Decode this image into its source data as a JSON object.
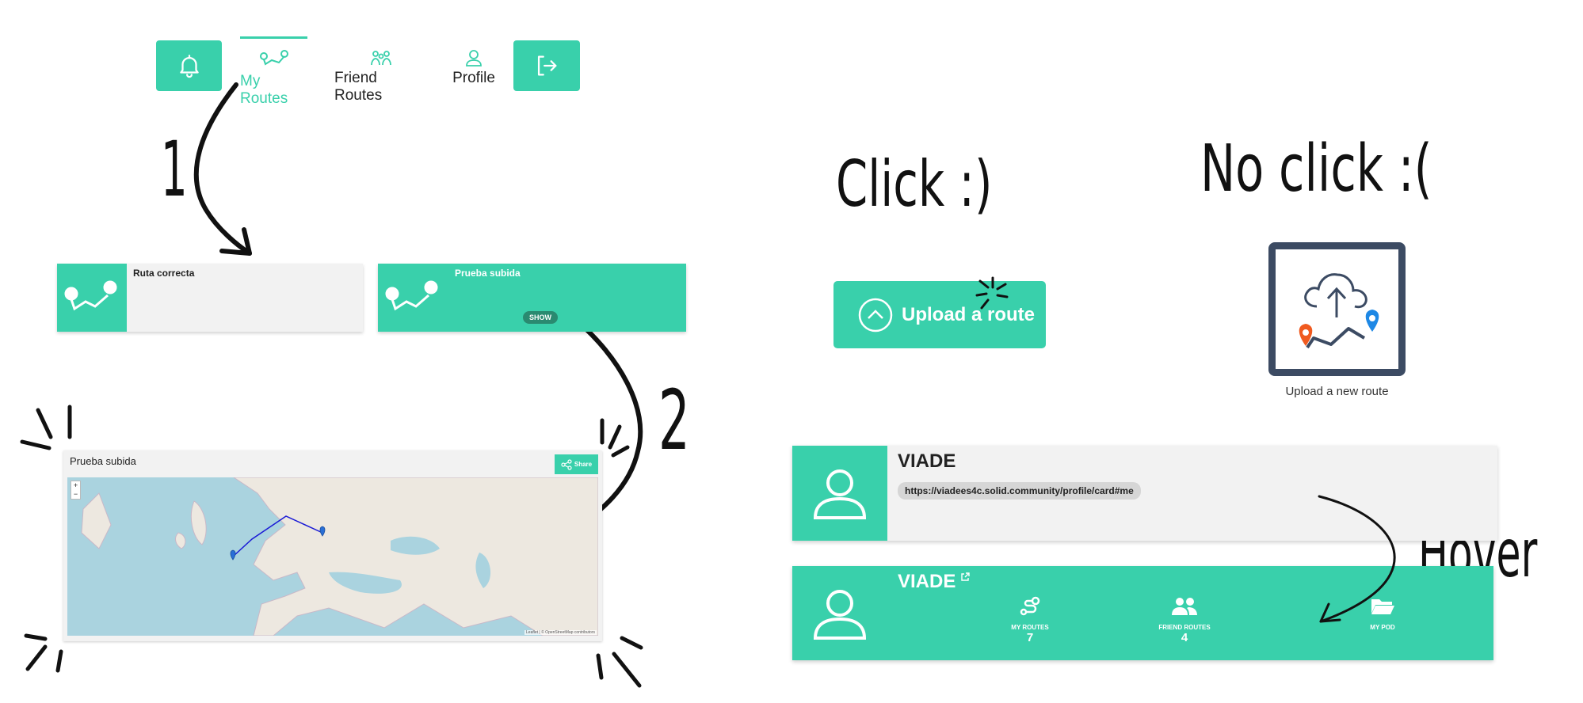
{
  "nav": {
    "items": [
      {
        "label": "My Routes",
        "icon": "route-icon",
        "active": true
      },
      {
        "label": "Friend Routes",
        "icon": "friends-icon",
        "active": false
      },
      {
        "label": "Profile",
        "icon": "user-icon",
        "active": false
      }
    ],
    "notifications_icon": "bell-icon",
    "logout_icon": "logout-icon"
  },
  "annotations": {
    "step1": "1",
    "step2": "2",
    "click": "Click :)",
    "no_click": "No click :(",
    "hover": "Hover"
  },
  "routes": [
    {
      "title": "Ruta correcta",
      "show_label": ""
    },
    {
      "title": "Prueba subida",
      "show_label": "SHOW"
    }
  ],
  "map_card": {
    "title": "Prueba subida",
    "share_label": "Share",
    "zoom_in": "+",
    "zoom_out": "−",
    "attribution": "Leaflet | © OpenStreetMap contributors"
  },
  "upload": {
    "button_label": "Upload a route",
    "tile_label": "Upload a new route"
  },
  "profile": {
    "name": "VIADE",
    "webid": "https://viadees4c.solid.community/profile/card#me",
    "stats": [
      {
        "label": "MY ROUTES",
        "value": "7",
        "icon": "route-icon"
      },
      {
        "label": "FRIEND ROUTES",
        "value": "4",
        "icon": "friends-icon"
      },
      {
        "label": "MY POD",
        "value": "",
        "icon": "folder-icon"
      }
    ]
  },
  "colors": {
    "accent": "#39d0ab",
    "card_bg": "#f2f2f2",
    "route_line": "#1a1ad6",
    "marker": "#2a6fd6",
    "upload_orange": "#f05a1f",
    "upload_blue": "#1e88e5",
    "tile_border": "#3c4b63"
  }
}
